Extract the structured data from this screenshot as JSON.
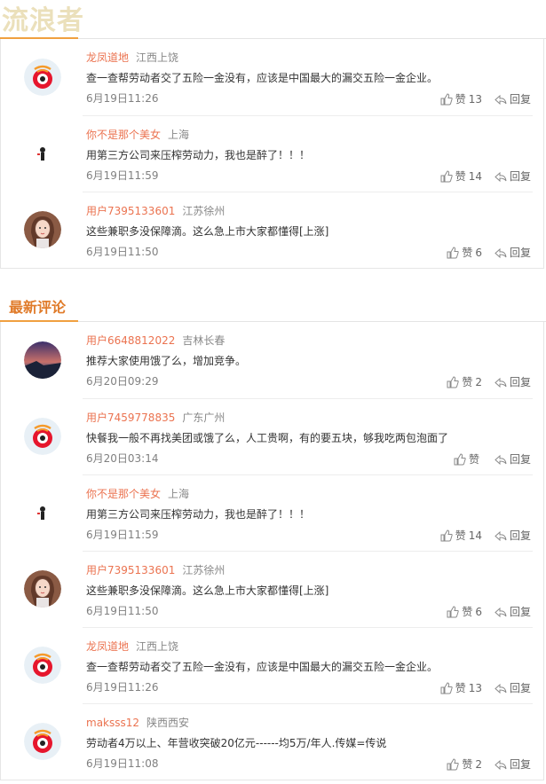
{
  "watermark": "流浪者",
  "section_partial": "",
  "section_latest": "最新评论",
  "hot_comments": [
    {
      "user": "龙凤道地",
      "location": "江西上饶",
      "text": "查一查帮劳动者交了五险一金没有，应该是中国最大的漏交五险一金企业。",
      "time": "6月19日11:26",
      "like_label": "赞",
      "likes": "13",
      "reply": "回复",
      "avatar": "weibo"
    },
    {
      "user": "你不是那个美女",
      "location": "上海",
      "text": "用第三方公司来压榨劳动力，我也是醉了！！！",
      "time": "6月19日11:59",
      "like_label": "赞",
      "likes": "14",
      "reply": "回复",
      "avatar": "figure"
    },
    {
      "user": "用户7395133601",
      "location": "江苏徐州",
      "text": "这些兼职多没保障滴。这么急上市大家都懂得[上涨]",
      "time": "6月19日11:50",
      "like_label": "赞",
      "likes": "6",
      "reply": "回复",
      "avatar": "girl"
    }
  ],
  "latest_comments": [
    {
      "user": "用户6648812022",
      "location": "吉林长春",
      "text": "推荐大家使用饿了么，增加竞争。",
      "time": "6月20日09:29",
      "like_label": "赞",
      "likes": "2",
      "reply": "回复",
      "avatar": "sunset"
    },
    {
      "user": "用户7459778835",
      "location": "广东广州",
      "text": "快餐我一般不再找美团或饿了么，人工贵啊，有的要五块，够我吃两包泡面了",
      "time": "6月20日03:14",
      "like_label": "赞",
      "likes": "",
      "reply": "回复",
      "avatar": "weibo"
    },
    {
      "user": "你不是那个美女",
      "location": "上海",
      "text": "用第三方公司来压榨劳动力，我也是醉了！！！",
      "time": "6月19日11:59",
      "like_label": "赞",
      "likes": "14",
      "reply": "回复",
      "avatar": "figure"
    },
    {
      "user": "用户7395133601",
      "location": "江苏徐州",
      "text": "这些兼职多没保障滴。这么急上市大家都懂得[上涨]",
      "time": "6月19日11:50",
      "like_label": "赞",
      "likes": "6",
      "reply": "回复",
      "avatar": "girl"
    },
    {
      "user": "龙凤道地",
      "location": "江西上饶",
      "text": "查一查帮劳动者交了五险一金没有，应该是中国最大的漏交五险一金企业。",
      "time": "6月19日11:26",
      "like_label": "赞",
      "likes": "13",
      "reply": "回复",
      "avatar": "weibo"
    },
    {
      "user": "maksss12",
      "location": "陕西西安",
      "text": "劳动者4万以上、年营收突破20亿元------均5万/年人.传媒=传说",
      "time": "6月19日11:08",
      "like_label": "赞",
      "likes": "2",
      "reply": "回复",
      "avatar": "weibo"
    }
  ],
  "colors": {
    "accent": "#e07b2a",
    "username": "#eb7350",
    "rule": "#f0a040"
  }
}
